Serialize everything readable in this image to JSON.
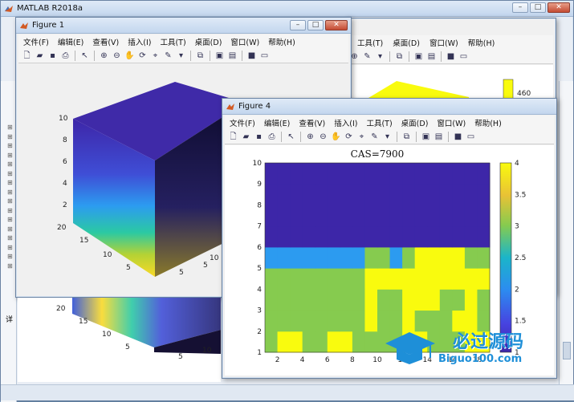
{
  "main_window": {
    "title": "MATLAB R2018a"
  },
  "figure1": {
    "title": "Figure 1",
    "menu": [
      "文件(F)",
      "编辑(E)",
      "查看(V)",
      "插入(I)",
      "工具(T)",
      "桌面(D)",
      "窗口(W)",
      "帮助(H)"
    ],
    "z_ticks": [
      "10",
      "8",
      "6",
      "4",
      "2"
    ],
    "y_ticks": [
      "20",
      "15",
      "10",
      "5"
    ],
    "x_ticks": [
      "5",
      "10"
    ],
    "x_ticks_front": [
      "5"
    ]
  },
  "figure_behind": {
    "menu": [
      "工具(T)",
      "桌面(D)",
      "窗口(W)",
      "帮助(H)"
    ],
    "colorbar_tick": "460",
    "y_ticks": [
      "20",
      "15",
      "10",
      "5"
    ],
    "x_ticks": [
      "5",
      "10"
    ]
  },
  "figure4": {
    "title": "Figure 4",
    "menu": [
      "文件(F)",
      "编辑(E)",
      "查看(V)",
      "插入(I)",
      "工具(T)",
      "桌面(D)",
      "窗口(W)",
      "帮助(H)"
    ]
  },
  "left_panel_text": "详",
  "watermark": {
    "title": "必过源码",
    "url": "Biguo100.com"
  },
  "colors": {
    "c1": "#3d26a8",
    "c2": "#2c9bf0",
    "c3": "#86cb4f",
    "c4": "#f9fb0e"
  },
  "chart_data": {
    "type": "heatmap",
    "title": "CAS=7900",
    "x_ticks": [
      2,
      4,
      6,
      8,
      10,
      12,
      14,
      16,
      18
    ],
    "y_ticks": [
      1,
      2,
      3,
      4,
      5,
      6,
      7,
      8,
      9,
      10
    ],
    "xlim": [
      1,
      19
    ],
    "ylim": [
      1,
      10
    ],
    "colorbar": {
      "min": 1,
      "max": 4,
      "ticks": [
        "1",
        "1.5",
        "2",
        "2.5",
        "3",
        "3.5",
        "4"
      ]
    },
    "rows": [
      [
        3,
        4,
        4,
        3,
        3,
        4,
        4,
        3,
        3,
        3,
        3,
        4,
        4,
        3,
        3,
        3,
        4,
        4
      ],
      [
        3,
        3,
        3,
        3,
        3,
        3,
        3,
        3,
        4,
        3,
        3,
        4,
        3,
        3,
        3,
        4,
        4,
        3
      ],
      [
        3,
        3,
        3,
        3,
        3,
        3,
        3,
        3,
        4,
        3,
        3,
        4,
        4,
        4,
        3,
        3,
        4,
        3
      ],
      [
        3,
        3,
        3,
        3,
        3,
        3,
        3,
        3,
        4,
        4,
        4,
        4,
        4,
        4,
        4,
        4,
        4,
        4
      ],
      [
        2,
        2,
        2,
        2,
        2,
        2,
        2,
        2,
        3,
        3,
        2,
        3,
        4,
        4,
        4,
        4,
        3,
        3
      ],
      [
        1,
        1,
        1,
        1,
        1,
        1,
        1,
        1,
        1,
        1,
        1,
        1,
        1,
        1,
        1,
        1,
        1,
        1
      ],
      [
        1,
        1,
        1,
        1,
        1,
        1,
        1,
        1,
        1,
        1,
        1,
        1,
        1,
        1,
        1,
        1,
        1,
        1
      ],
      [
        1,
        1,
        1,
        1,
        1,
        1,
        1,
        1,
        1,
        1,
        1,
        1,
        1,
        1,
        1,
        1,
        1,
        1
      ],
      [
        1,
        1,
        1,
        1,
        1,
        1,
        1,
        1,
        1,
        1,
        1,
        1,
        1,
        1,
        1,
        1,
        1,
        1
      ]
    ]
  }
}
